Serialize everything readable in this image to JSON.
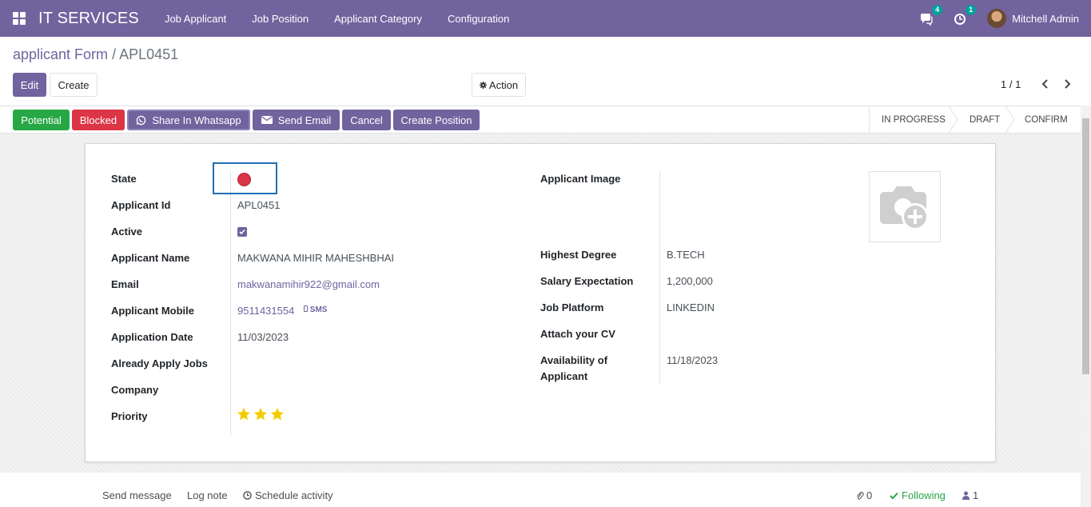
{
  "navbar": {
    "brand": "IT SERVICES",
    "menu": [
      "Job Applicant",
      "Job Position",
      "Applicant Category",
      "Configuration"
    ],
    "messages_count": "4",
    "activities_count": "1",
    "user_name": "Mitchell Admin"
  },
  "breadcrumb": {
    "parent": "applicant Form",
    "separator": "/",
    "current": "APL0451"
  },
  "controls": {
    "edit": "Edit",
    "create": "Create",
    "action": "Action",
    "pager": "1 / 1"
  },
  "statusbar": {
    "buttons": [
      "Potential",
      "Blocked",
      "Share In Whatsapp",
      "Send Email",
      "Cancel",
      "Create Position"
    ],
    "stages": [
      "IN PROGRESS",
      "DRAFT",
      "CONFIRM"
    ]
  },
  "form": {
    "labels_left": [
      "State",
      "Applicant Id",
      "Active",
      "Applicant Name",
      "Email",
      "Applicant Mobile",
      "Application Date",
      "Already Apply Jobs",
      "Company",
      "Priority"
    ],
    "applicant_id": "APL0451",
    "active": true,
    "applicant_name": "MAKWANA MIHIR MAHESHBHAI",
    "email": "makwanamihir922@gmail.com",
    "mobile": "9511431554",
    "sms_label": "SMS",
    "application_date": "11/03/2023",
    "priority_stars": 3,
    "labels_right": [
      "Applicant Image",
      "Highest Degree",
      "Salary Expectation",
      "Job Platform",
      "Attach your CV",
      "Availability of",
      "Applicant"
    ],
    "highest_degree": "B.TECH",
    "salary_expectation": "1,200,000",
    "job_platform": "LINKEDIN",
    "availability": "11/18/2023"
  },
  "chatter": {
    "send_message": "Send message",
    "log_note": "Log note",
    "schedule_activity": "Schedule activity",
    "attachments": "0",
    "following": "Following",
    "followers": "1"
  },
  "colors": {
    "brand": "#71639e",
    "success": "#28a745",
    "danger": "#dc3545",
    "star": "#f3cc00"
  }
}
